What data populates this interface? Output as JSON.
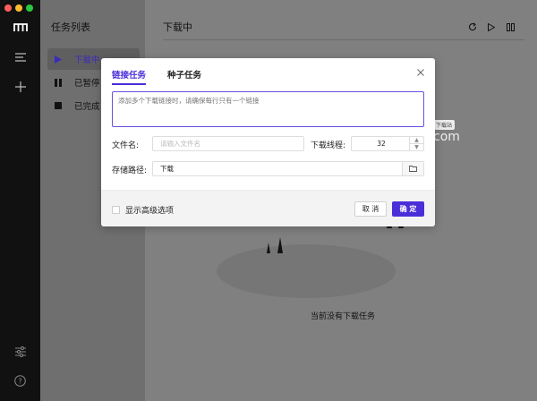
{
  "sidebar": {
    "title": "任务列表",
    "items": [
      {
        "label": "下载中",
        "icon": "play-icon"
      },
      {
        "label": "已暂停",
        "icon": "pause-icon"
      },
      {
        "label": "已完成",
        "icon": "stop-icon"
      }
    ]
  },
  "main": {
    "title": "下载中",
    "empty_text": "当前没有下载任务",
    "watermark_badge": "下载站",
    "watermark_text": "com"
  },
  "dialog": {
    "tabs": [
      {
        "label": "链接任务"
      },
      {
        "label": "种子任务"
      }
    ],
    "url_placeholder": "添加多个下载链接时，请确保每行只有一个链接",
    "filename_label": "文件名:",
    "filename_placeholder": "请输入文件名",
    "threads_label": "下载线程:",
    "threads_value": "32",
    "path_label": "存储路径:",
    "path_value": "下载",
    "advanced_label": "显示高级选项",
    "cancel_label": "取 消",
    "ok_label": "确 定"
  },
  "colors": {
    "accent": "#4a2fd8",
    "rail": "#111111",
    "overlay": "#808080"
  }
}
